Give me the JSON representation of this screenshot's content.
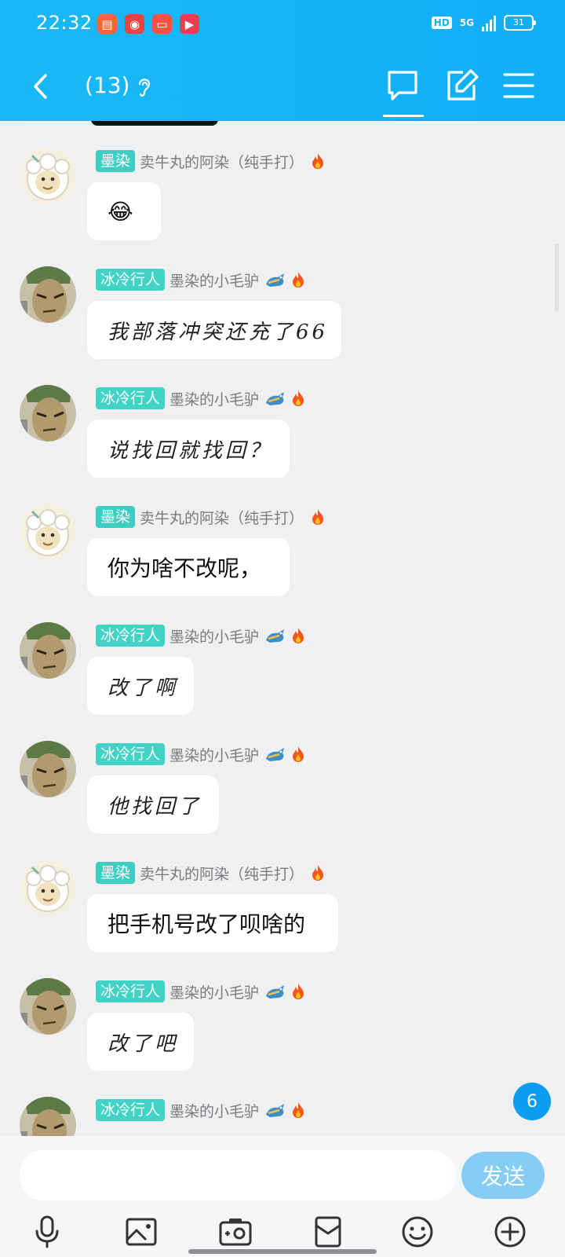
{
  "status": {
    "time": "22:32",
    "network": "5G",
    "hd": "HD",
    "battery": "31",
    "apps": [
      {
        "icon": "book-app-icon",
        "color": "#f2663a"
      },
      {
        "icon": "weibo-app-icon",
        "color": "#e8433e"
      },
      {
        "icon": "game-app-icon",
        "color": "#f05540"
      },
      {
        "icon": "video-app-icon",
        "color": "#ef3c53"
      }
    ]
  },
  "header": {
    "title": "(13)",
    "icons": [
      "back-icon",
      "ear-icon",
      "chat-tab-icon",
      "edit-icon",
      "menu-icon"
    ]
  },
  "colors": {
    "header": "#12b0f6",
    "tag_mo": "#3ecfc3",
    "tag_bing": "#40d3c6",
    "unread": "#0c9cf0",
    "send": "#86cdf6"
  },
  "messages": [
    {
      "sender": "mo",
      "tag": "墨染",
      "name": "卖牛丸的阿染（纯手打）",
      "text": "😂",
      "hand": false
    },
    {
      "sender": "bing",
      "tag": "冰冷行人",
      "name": "墨染的小毛驴",
      "text": "我部落冲突还充了66",
      "hand": true
    },
    {
      "sender": "bing",
      "tag": "冰冷行人",
      "name": "墨染的小毛驴",
      "text": "说找回就找回？",
      "hand": true
    },
    {
      "sender": "mo",
      "tag": "墨染",
      "name": "卖牛丸的阿染（纯手打）",
      "text": "你为啥不改呢，",
      "hand": false
    },
    {
      "sender": "bing",
      "tag": "冰冷行人",
      "name": "墨染的小毛驴",
      "text": "改了啊",
      "hand": true
    },
    {
      "sender": "bing",
      "tag": "冰冷行人",
      "name": "墨染的小毛驴",
      "text": "他找回了",
      "hand": true
    },
    {
      "sender": "mo",
      "tag": "墨染",
      "name": "卖牛丸的阿染（纯手打）",
      "text": "把手机号改了呗啥的",
      "hand": false
    },
    {
      "sender": "bing",
      "tag": "冰冷行人",
      "name": "墨染的小毛驴",
      "text": "改了吧",
      "hand": true
    },
    {
      "sender": "bing",
      "tag": "冰冷行人",
      "name": "墨染的小毛驴",
      "text": "",
      "hand": true
    }
  ],
  "unread_count": "6",
  "input": {
    "placeholder": "",
    "send_label": "发送"
  },
  "toolbar": [
    "microphone-icon",
    "image-icon",
    "camera-icon",
    "red-packet-icon",
    "emoji-icon",
    "plus-icon"
  ]
}
